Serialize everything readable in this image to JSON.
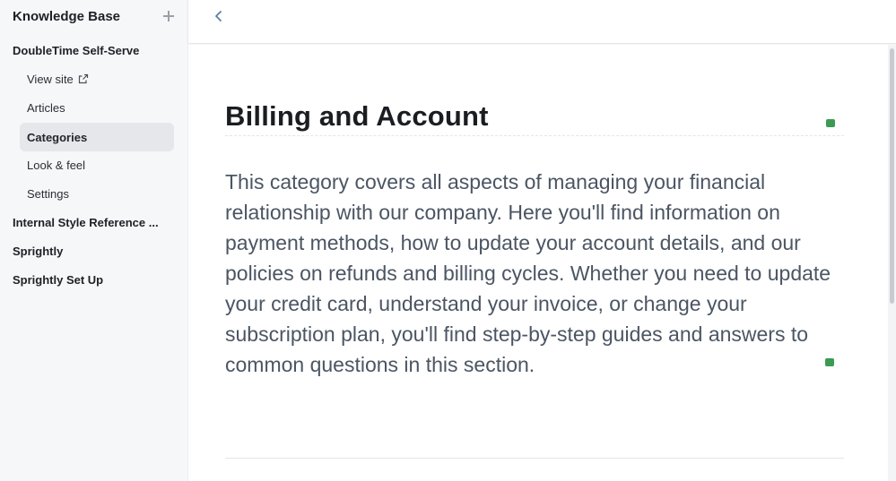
{
  "sidebar": {
    "title": "Knowledge Base",
    "add_icon": "plus-icon",
    "sections": [
      {
        "label": "DoubleTime Self-Serve"
      },
      {
        "label": "Internal Style Reference ..."
      },
      {
        "label": "Sprightly"
      },
      {
        "label": "Sprightly Set Up"
      }
    ],
    "items": [
      {
        "label": "View site",
        "icon": "external-link-icon"
      },
      {
        "label": "Articles"
      },
      {
        "label": "Categories",
        "active": true
      },
      {
        "label": "Look & feel"
      },
      {
        "label": "Settings"
      }
    ]
  },
  "topbar": {
    "back_icon": "chevron-left-icon"
  },
  "main": {
    "title": "Billing and Account",
    "description": "This category covers all aspects of managing your financial relationship with our company. Here you'll find information on payment methods, how to update your account details, and our policies on refunds and billing cycles. Whether you need to update your credit card, understand your invoice, or change your subscription plan, you'll find step-by-step guides and answers to common questions in this section."
  },
  "colors": {
    "accent_green": "#3c9a55",
    "sidebar_bg": "#f6f7f9",
    "active_item_bg": "#e5e7eb"
  }
}
